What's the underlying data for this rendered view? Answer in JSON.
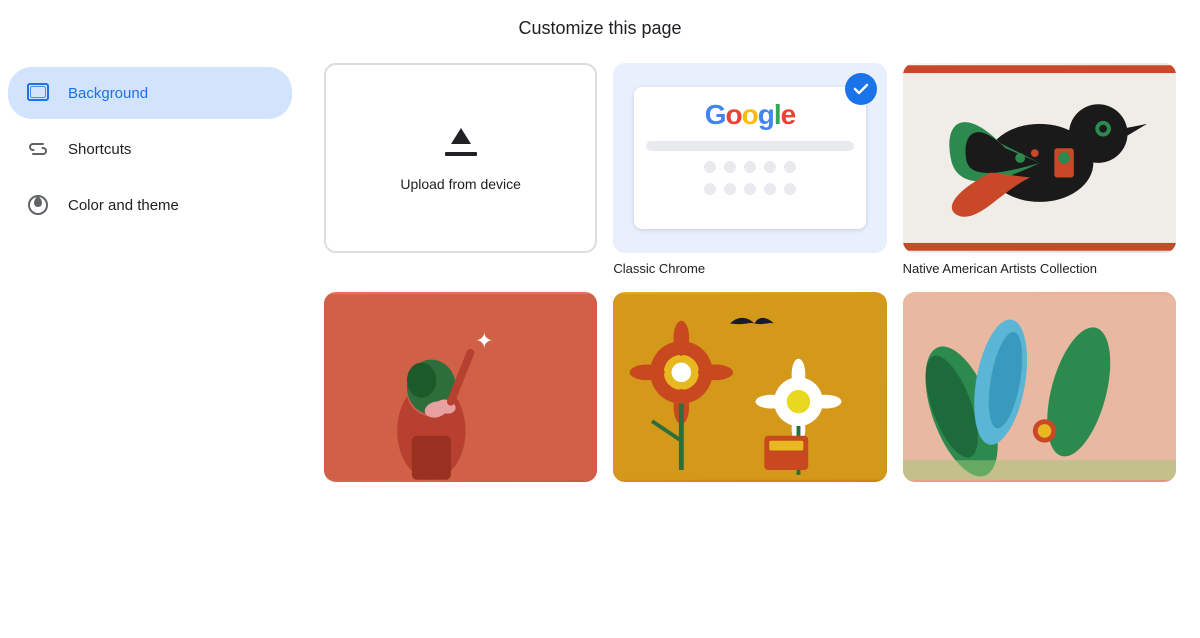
{
  "header": {
    "title": "Customize this page"
  },
  "sidebar": {
    "items": [
      {
        "id": "background",
        "label": "Background",
        "icon": "background-icon",
        "active": true
      },
      {
        "id": "shortcuts",
        "label": "Shortcuts",
        "icon": "shortcuts-icon",
        "active": false
      },
      {
        "id": "color-theme",
        "label": "Color and theme",
        "icon": "color-theme-icon",
        "active": false
      }
    ]
  },
  "content": {
    "cards": [
      {
        "id": "upload",
        "type": "upload",
        "label": "Upload from device",
        "selected": false
      },
      {
        "id": "classic-chrome",
        "type": "classic",
        "label": "Classic Chrome",
        "selected": true
      },
      {
        "id": "native-american",
        "type": "native",
        "label": "Native American Artists Collection",
        "selected": false
      },
      {
        "id": "art-orange",
        "type": "art-orange",
        "label": "",
        "selected": false
      },
      {
        "id": "art-yellow",
        "type": "art-yellow",
        "label": "",
        "selected": false
      },
      {
        "id": "art-green",
        "type": "art-green",
        "label": "",
        "selected": false
      }
    ],
    "google_logo": {
      "g": "G",
      "o1": "o",
      "o2": "o",
      "g2": "g",
      "l": "l",
      "e": "e"
    }
  },
  "colors": {
    "accent_blue": "#1a73e8",
    "sidebar_active_bg": "#d2e3fc",
    "border": "#dadce0"
  }
}
